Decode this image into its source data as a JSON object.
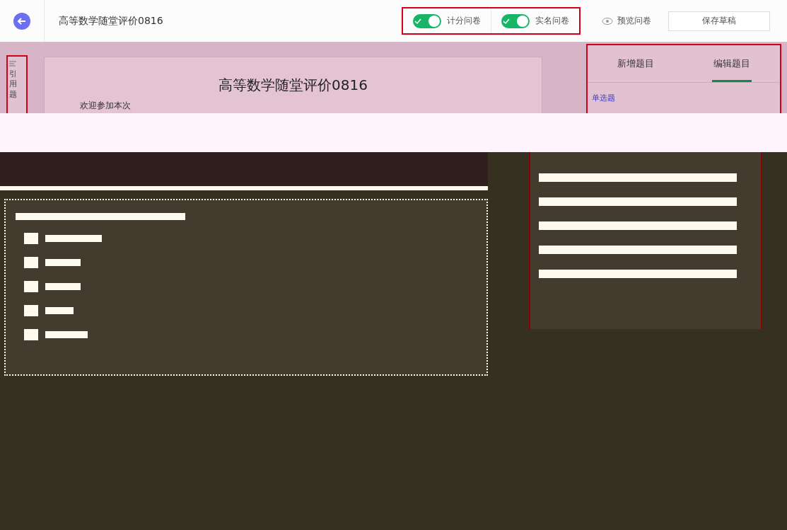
{
  "header": {
    "title": "高等数学随堂评价0816",
    "toggles": [
      {
        "label": "计分问卷",
        "on": true
      },
      {
        "label": "实名问卷",
        "on": true
      }
    ],
    "preview": "预览问卷",
    "save": "保存草稿"
  },
  "sidebar": {
    "label": "引用题"
  },
  "survey": {
    "title": "高等数学随堂评价0816",
    "intro": "欢迎参加本次"
  },
  "panel": {
    "tabs": [
      {
        "label": "新增题目",
        "selected": false
      },
      {
        "label": "编辑题目",
        "selected": true
      }
    ],
    "type_link": "单选题"
  }
}
